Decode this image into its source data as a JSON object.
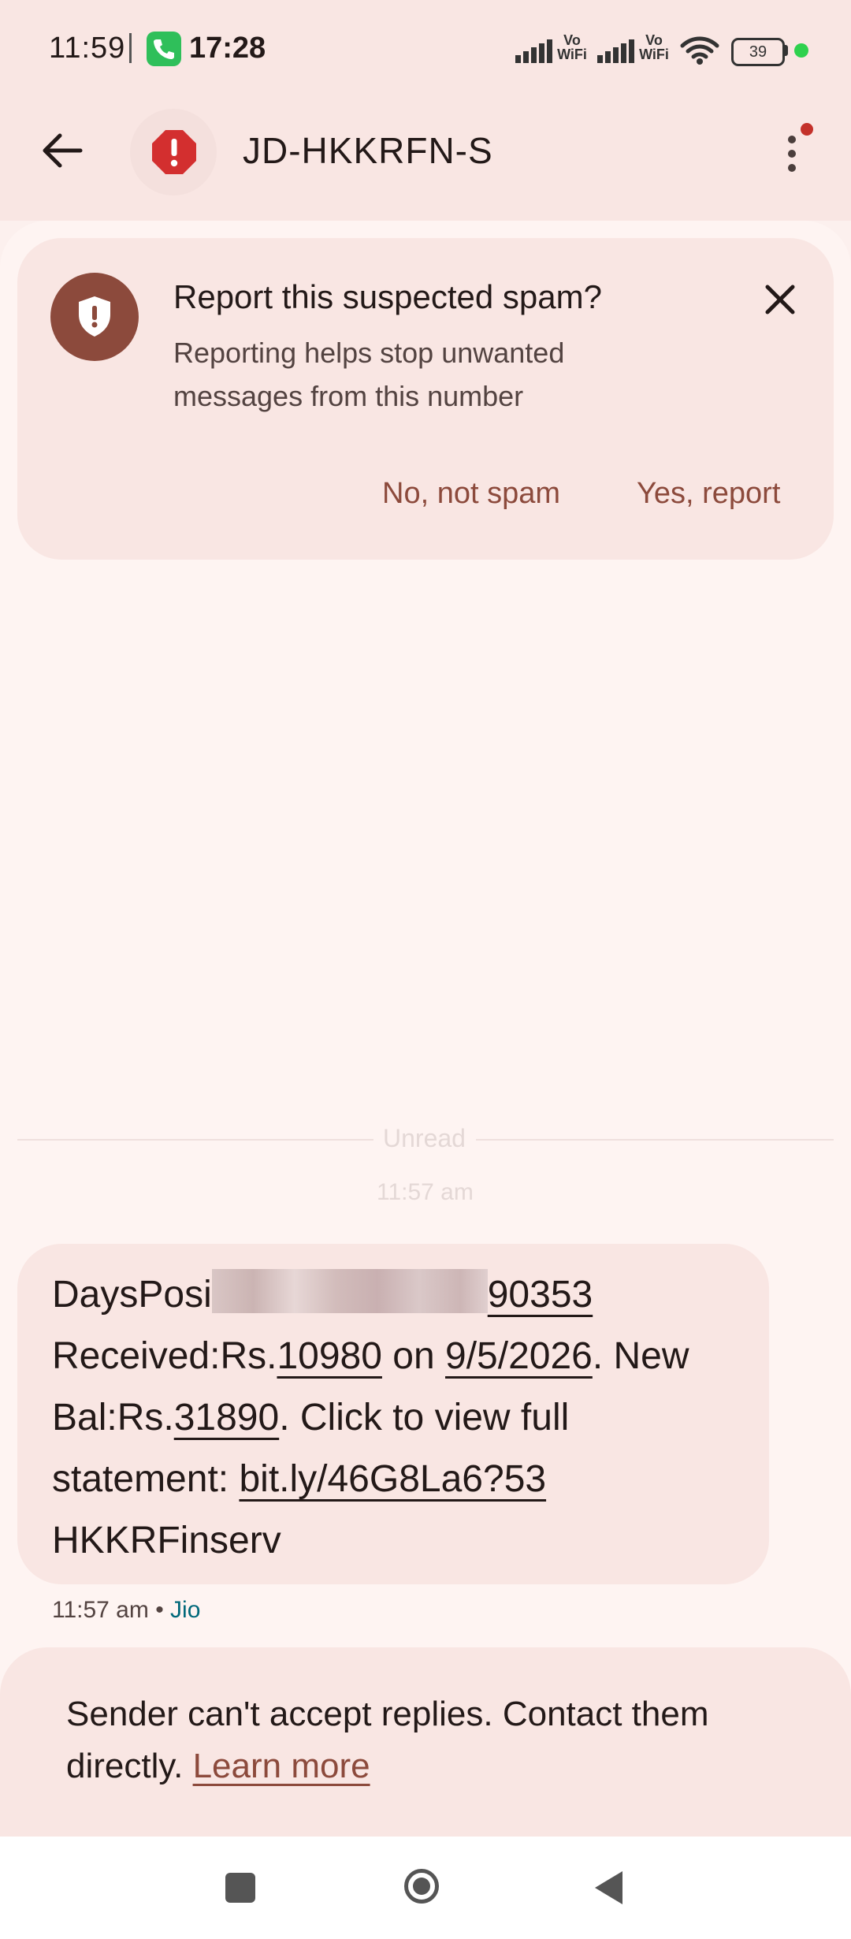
{
  "status_bar": {
    "time": "11:59",
    "call_time": "17:28",
    "network_label_1": "Vo WiFi",
    "network_label_2": "Vo WiFi",
    "battery": "39"
  },
  "header": {
    "title": "JD-HKKRFN-S",
    "icons": [
      "back-arrow-icon",
      "alert-icon",
      "more-vert-icon"
    ]
  },
  "spam_banner": {
    "title": "Report this suspected spam?",
    "description": "Reporting helps stop unwanted messages from this number",
    "no_label": "No, not spam",
    "yes_label": "Yes, report"
  },
  "thread": {
    "unread_label": "Unread",
    "timestamp": "11:57 am",
    "message": {
      "prefix": "DaysPosi",
      "account_tail": "90353",
      "received_label": "Received:Rs.",
      "amount": "10980",
      "on_label": " on ",
      "date": "9/5/2026",
      "new_bal_label": ". New Bal:Rs.",
      "balance": "31890",
      "click_label": ". Click to view full statement: ",
      "link": "bit.ly/46G8La6?53",
      "signature": "HKKRFinserv"
    },
    "meta_time": "11:57 am",
    "meta_sep": " • ",
    "carrier": "Jio"
  },
  "footer": {
    "notice": "Sender can't accept replies. Contact them directly. ",
    "learn_more": "Learn more"
  },
  "colors": {
    "accent": "#8c4a3c",
    "alert_red": "#d32f2f",
    "carrier_teal": "#00687a"
  }
}
